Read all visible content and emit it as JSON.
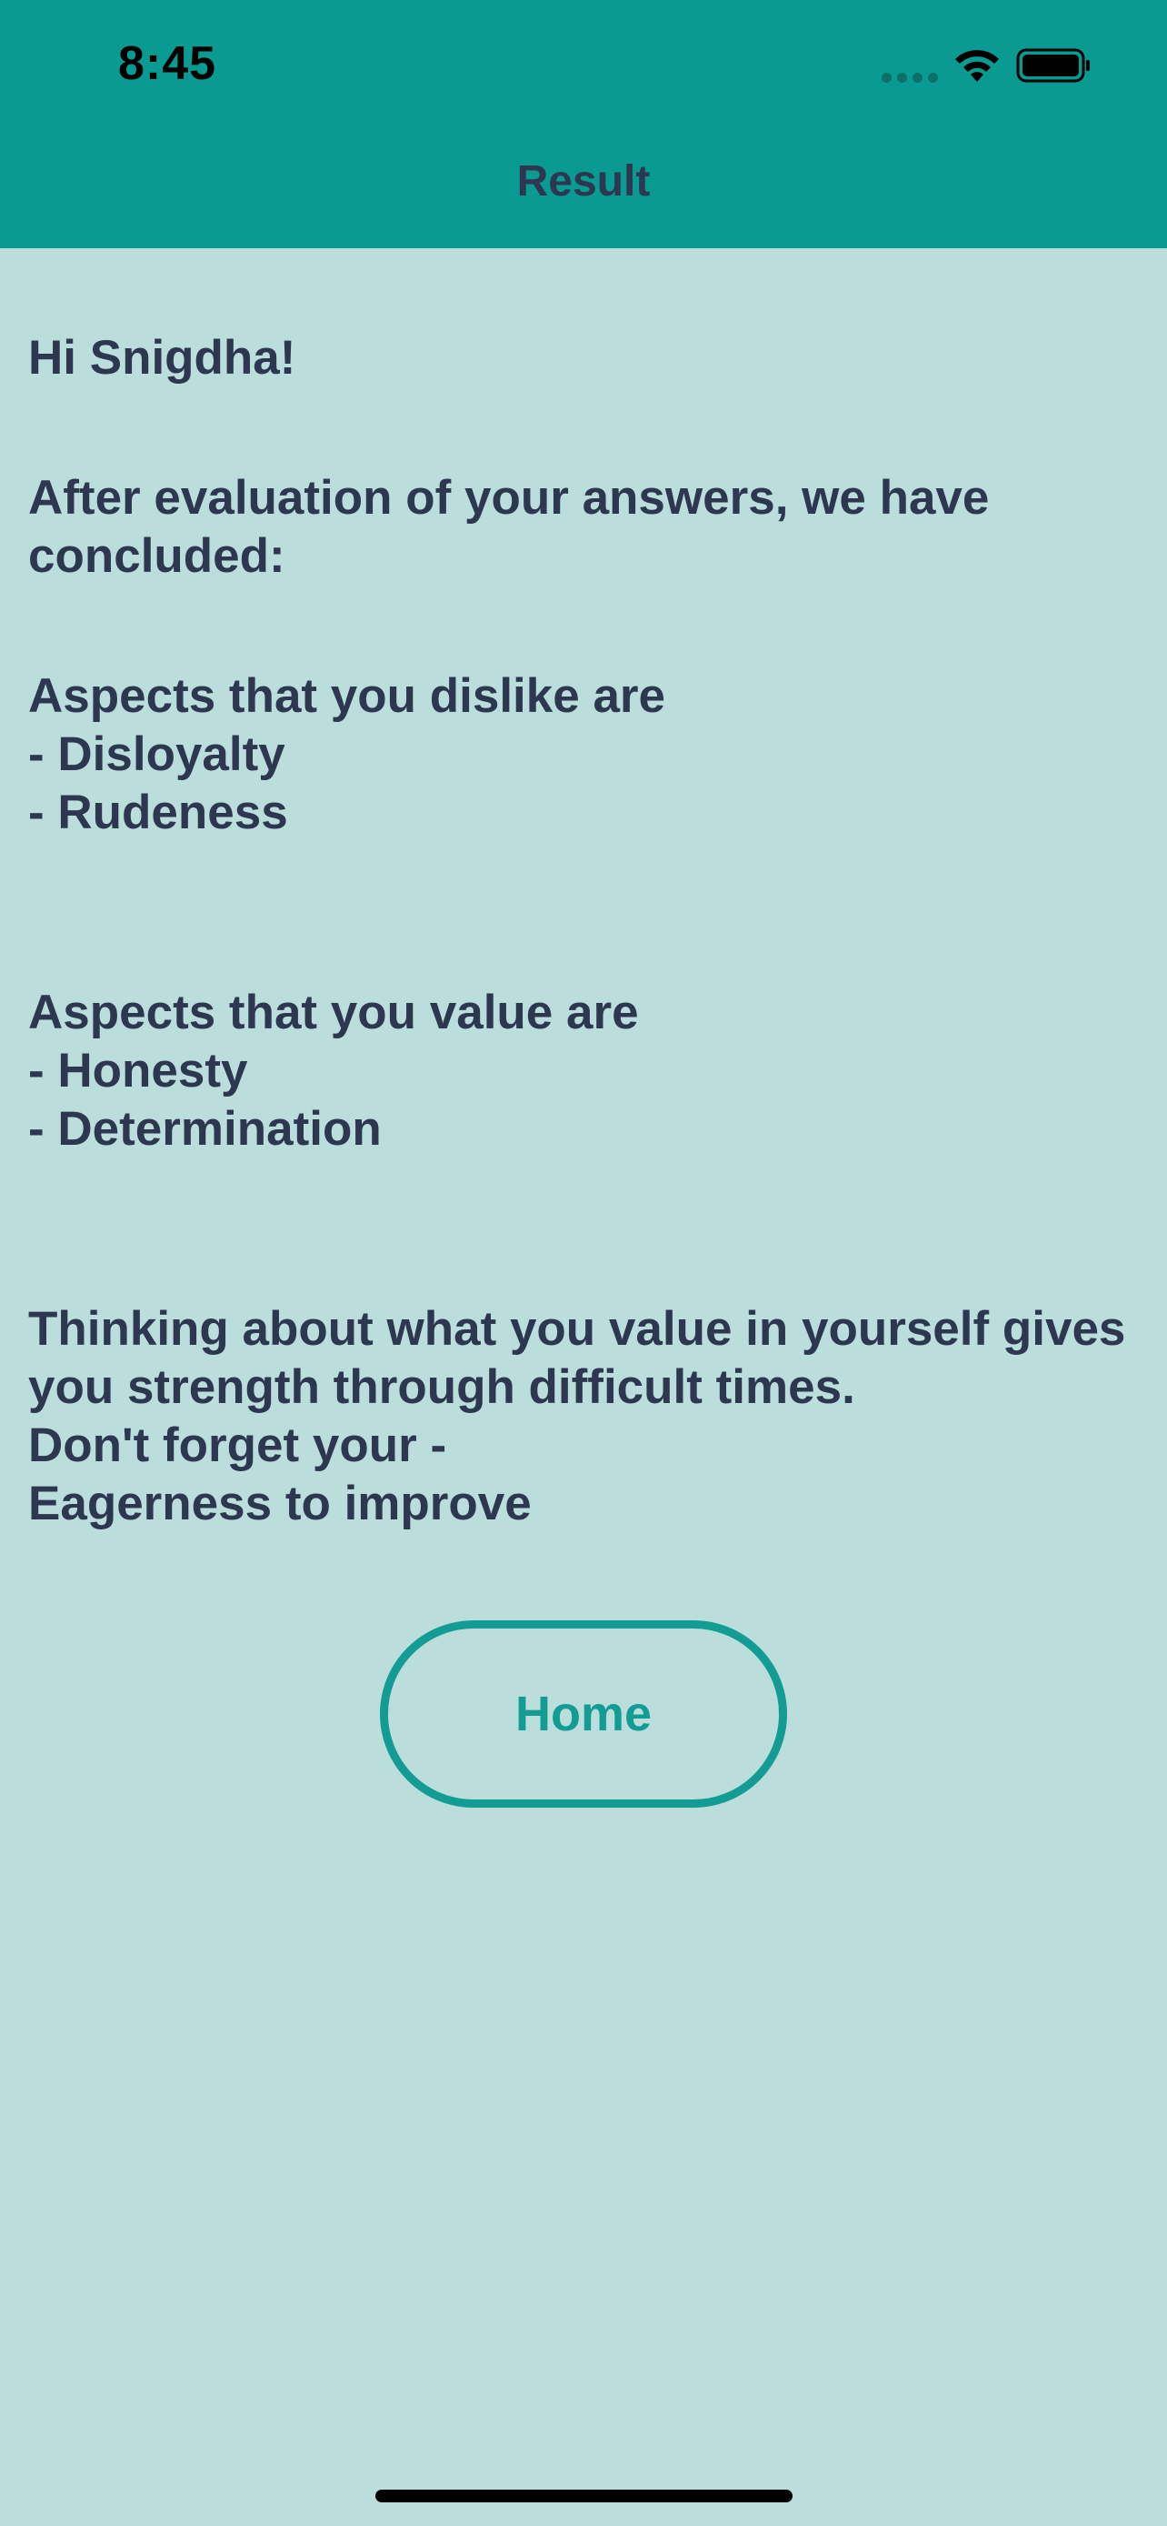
{
  "status_bar": {
    "time": "8:45"
  },
  "nav": {
    "title": "Result"
  },
  "content": {
    "greeting": "Hi Snigdha!",
    "intro": "After evaluation of your answers, we have\nconcluded:",
    "dislike_block": "Aspects that you dislike are\n- Disloyalty\n- Rudeness",
    "value_block": "Aspects that you value are\n- Honesty\n- Determination",
    "closing_block": "Thinking about what you value in yourself gives\nyou strength through difficult times.\n Don't forget your -\nEagerness to improve"
  },
  "home_button": {
    "label": "Home"
  },
  "colors": {
    "header_bg": "#099a91",
    "page_bg": "#bbdedc",
    "text": "#2d3850",
    "accent": "#139c94"
  },
  "icons": {
    "signal": "cellular-signal-icon",
    "wifi": "wifi-icon",
    "battery": "battery-icon"
  }
}
